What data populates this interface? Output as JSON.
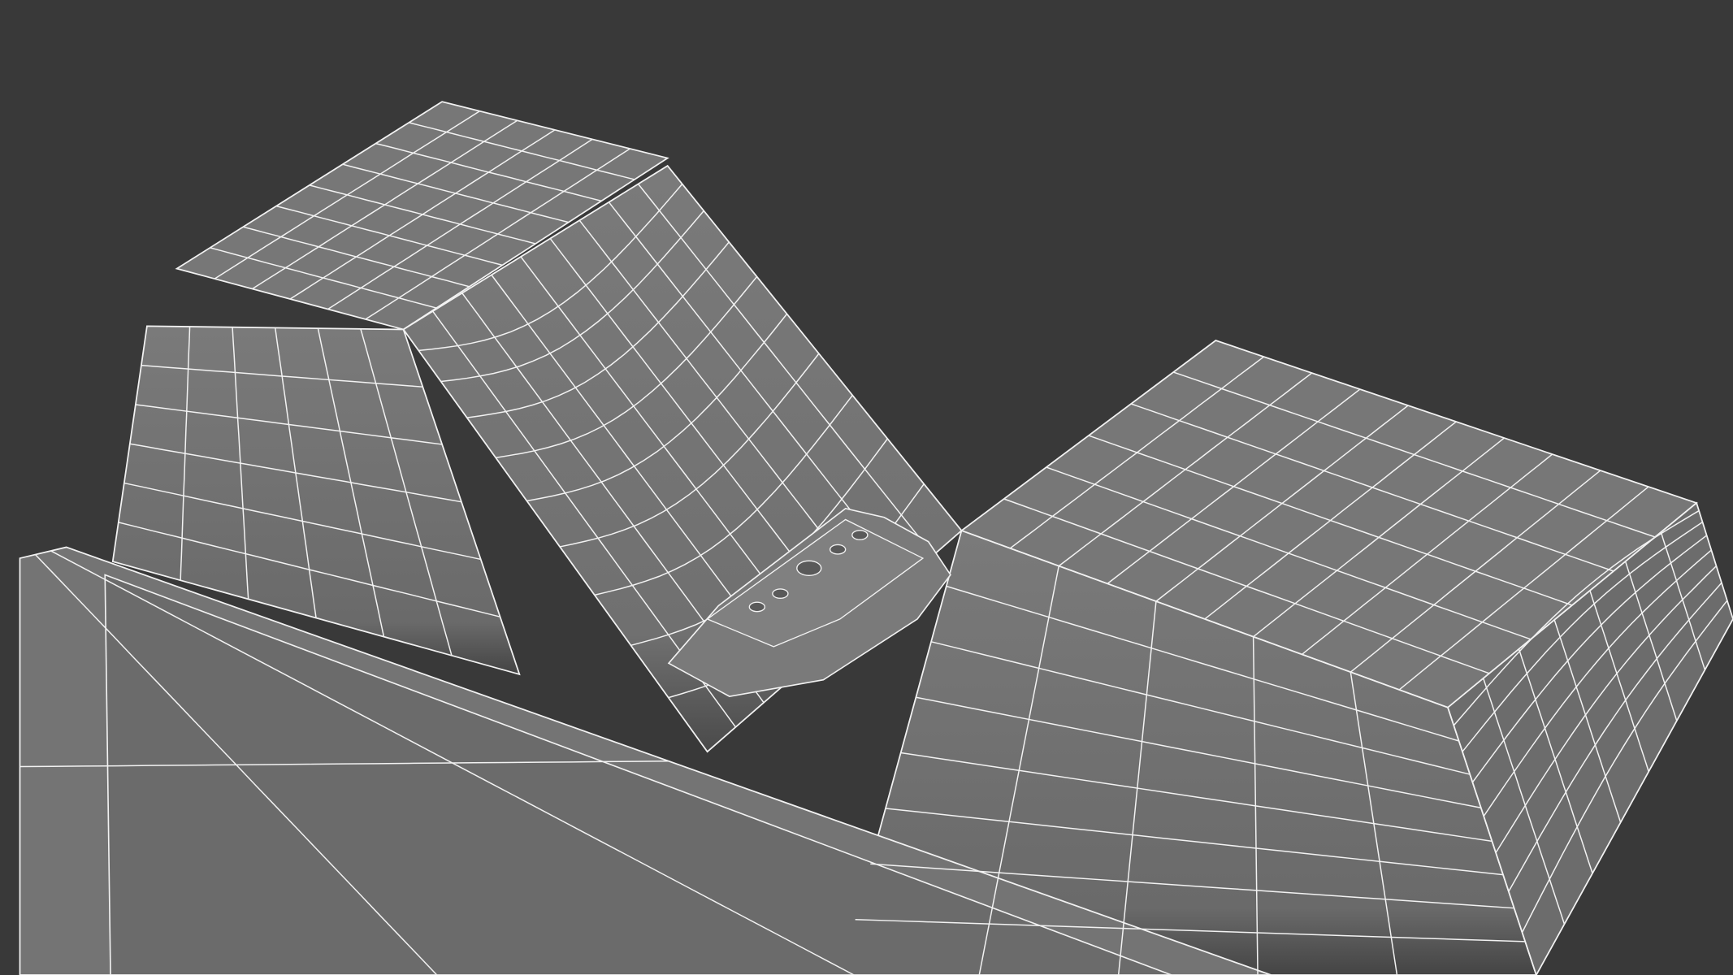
{
  "scene": {
    "subject": "wireframe-model",
    "colors": {
      "background": "#393939",
      "surface": "#777777",
      "surface_dark": "#5a5a5a",
      "wire": "#f2f2f2"
    }
  }
}
